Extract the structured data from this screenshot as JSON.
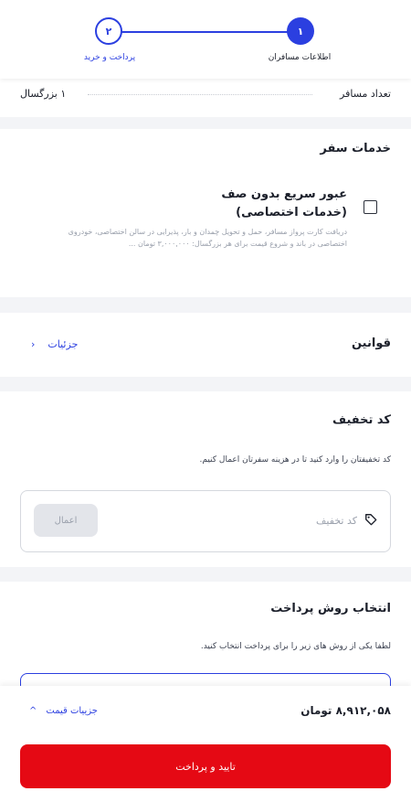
{
  "stepper": {
    "steps": [
      {
        "number": "۱",
        "label": "اطلاعات مسافران"
      },
      {
        "number": "۲",
        "label": "پرداخت و خرید"
      }
    ]
  },
  "passengers": {
    "label": "تعداد مسافر",
    "value": "۱ بزرگسال"
  },
  "services": {
    "title": "خدمات سفر",
    "item_name": "عبور سریع بدون صف (خدمات اختصاصی)",
    "item_description": "دریافت کارت پرواز مسافر، حمل و تحویل چمدان و بار، پذیرایی در سالن اختصاصی، خودروی اختصاصی در باند و شروع قیمت برای هر بزرگسال: ۳,۰۰۰,۰۰۰ تومان ..."
  },
  "rules": {
    "title": "قوانین",
    "link": "جزئیات"
  },
  "discount": {
    "title": "کد تخفیف",
    "hint": "کد تخفیفتان را وارد کنید تا در هزینه سفرتان اعمال کنیم.",
    "placeholder": "کد تخفیف",
    "apply_label": "اعمال"
  },
  "payment": {
    "title": "انتخاب روش پرداخت",
    "hint": "لطفا یکی از روش های زیر را برای پرداخت انتخاب کنید."
  },
  "footer": {
    "price": "۸,۹۱۲,۰۵۸ تومان",
    "price_details": "جزییات قیمت",
    "pay_label": "تایید و پرداخت"
  },
  "colors": {
    "accent": "#2b3fe0",
    "primary_button": "#e50914"
  }
}
